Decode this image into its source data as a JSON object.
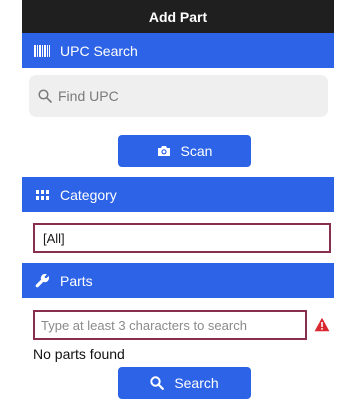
{
  "window": {
    "title": "Add Part"
  },
  "upc_section": {
    "label": "UPC Search",
    "icon": "barcode-icon"
  },
  "upc_search": {
    "placeholder": "Find UPC",
    "icon": "search-icon"
  },
  "scan_button": {
    "label": "Scan",
    "icon": "camera-icon"
  },
  "category_section": {
    "label": "Category",
    "icon": "grid-icon"
  },
  "category_select": {
    "value": "[All]"
  },
  "parts_section": {
    "label": "Parts",
    "icon": "wrench-icon"
  },
  "parts_search": {
    "placeholder": "Type at least 3 characters to search",
    "warning_icon": "warning-icon"
  },
  "status": {
    "text": "No parts found"
  },
  "search_button": {
    "label": "Search",
    "icon": "search-icon"
  },
  "colors": {
    "accent": "#2d63e6",
    "title_bar": "#1f1f1f",
    "error_border": "#8a2e4e",
    "warning": "#d9282f"
  }
}
